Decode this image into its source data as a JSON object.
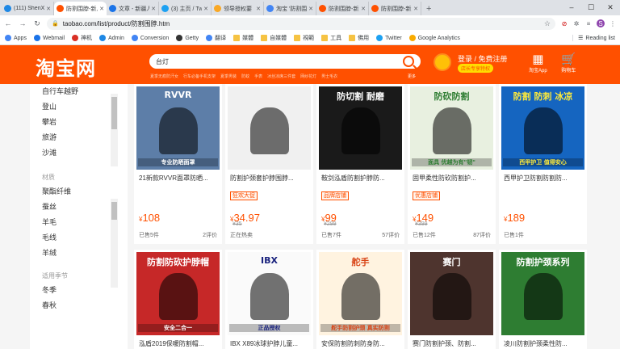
{
  "browser": {
    "tabs": [
      {
        "title": "(111) ShenXun",
        "color": "#1e88e5"
      },
      {
        "title": "防割围脖-新人 ",
        "color": "#ff5000",
        "active": true
      },
      {
        "title": "文章 - 新疆人",
        "color": "#1a73e8"
      },
      {
        "title": "(3) 主页 / Twit",
        "color": "#1da1f2"
      },
      {
        "title": "领导授权要",
        "color": "#f9a825"
      },
      {
        "title": "淘宝 '防割围",
        "color": "#4285f4"
      },
      {
        "title": "防割围脖-新人",
        "color": "#ff5000"
      },
      {
        "title": "防割围脖-新人",
        "color": "#ff5000"
      }
    ],
    "new_tab": "+",
    "url": "taobao.com/list/product/防割围脖.htm",
    "bookmarks": [
      "Apps",
      "Webmail",
      "神机",
      "Admin",
      "Conversion",
      "Getty",
      "翻译",
      "媒體",
      "自媒體",
      "視範",
      "工具",
      "佛用",
      "Twitter",
      "Google Analytics"
    ],
    "reading_list": "Reading list"
  },
  "header": {
    "logo": "淘宝网",
    "search_value": "台灯",
    "hotwords": [
      "夏季无痕防汗女",
      "行车必备手机支架",
      "夏季男装",
      "防蚊",
      "手表",
      "冰丝凉席三件套",
      "网纱花灯",
      "男士毛衣"
    ],
    "more": "更多",
    "login": "登录 / 免费注册",
    "tag": "店长专享特权",
    "icons": [
      {
        "label": "淘宝App",
        "glyph": "▦"
      },
      {
        "label": "购物车",
        "glyph": "🛒"
      }
    ]
  },
  "sidebar": {
    "section1": {
      "items": [
        "自行车越野",
        "登山",
        "攀岩",
        "旅游",
        "沙滩"
      ]
    },
    "section2": {
      "heading": "材质",
      "items": [
        "聚酯纤维",
        "蚕丝",
        "羊毛",
        "毛线",
        "羊绒"
      ]
    },
    "section3": {
      "heading": "适用季节",
      "items": [
        "冬季",
        "春秋"
      ]
    }
  },
  "products": [
    {
      "name": "21新款RVVR面罩防晒...",
      "price": "108",
      "badge": "",
      "orig": "",
      "sold": "已售5件",
      "reviews": "2评价",
      "img": {
        "bg": "#5d7ea8",
        "text": "RVVR",
        "text2": "专业防晒面罩",
        "fg": "#fff"
      }
    },
    {
      "name": "防割护颈套护脖围脖...",
      "price": "34.97",
      "badge": "狂欢大促",
      "orig": "¥35",
      "sold": "正在热卖",
      "reviews": "",
      "img": {
        "bg": "#f0f0f0",
        "text": "",
        "text2": "",
        "fg": "#222"
      }
    },
    {
      "name": "鞍剑泓盾防割护脖防...",
      "price": "99",
      "badge": "品牌店铺",
      "orig": "¥299",
      "sold": "已售7件",
      "reviews": "57评价",
      "img": {
        "bg": "#1a1a1a",
        "text": "防切割 耐磨",
        "text2": "",
        "fg": "#fff"
      }
    },
    {
      "name": "固甲柔性防砍防割护...",
      "price": "149",
      "badge": "优惠店铺",
      "orig": "¥399",
      "sold": "已售12件",
      "reviews": "87评价",
      "img": {
        "bg": "#e8f0e0",
        "text": "防砍防割",
        "text2": "面具 优越为有\"韧\"",
        "fg": "#2e7d32"
      }
    },
    {
      "name": "西甲护卫防割防割防...",
      "price": "189",
      "badge": "",
      "orig": "",
      "sold": "已售1件",
      "reviews": "",
      "img": {
        "bg": "#1565c0",
        "text": "防割 防刺 冰凉",
        "text2": "西甲护卫 值得安心",
        "fg": "#ffeb3b"
      }
    },
    {
      "name": "泓盾2019保暖防割帽...",
      "price": "",
      "badge": "",
      "orig": "",
      "sold": "",
      "reviews": "",
      "img": {
        "bg": "#c62828",
        "text": "防割防砍护脖帽",
        "text2": "安全二合一",
        "fg": "#fff"
      }
    },
    {
      "name": "IBX X89冰球护脖儿童...",
      "price": "",
      "badge": "",
      "orig": "",
      "sold": "",
      "reviews": "",
      "img": {
        "bg": "#fafafa",
        "text": "IBX",
        "text2": "正品授权",
        "fg": "#1a237e"
      }
    },
    {
      "name": "安保防割防刺防身防...",
      "price": "",
      "badge": "",
      "orig": "",
      "sold": "",
      "reviews": "",
      "img": {
        "bg": "#fff3e0",
        "text": "舵手",
        "text2": "舵手防割护颈 真实防割",
        "fg": "#d84315"
      }
    },
    {
      "name": "赛门防割护颈、防割...",
      "price": "",
      "badge": "",
      "orig": "",
      "sold": "",
      "reviews": "",
      "img": {
        "bg": "#4e342e",
        "text": "赛门",
        "text2": "",
        "fg": "#fff"
      }
    },
    {
      "name": "凌川防割护颈柔性防...",
      "price": "",
      "badge": "",
      "orig": "",
      "sold": "",
      "reviews": "",
      "img": {
        "bg": "#2e7d32",
        "text": "防割护颈系列",
        "text2": "",
        "fg": "#fff"
      }
    }
  ],
  "currency": "¥"
}
